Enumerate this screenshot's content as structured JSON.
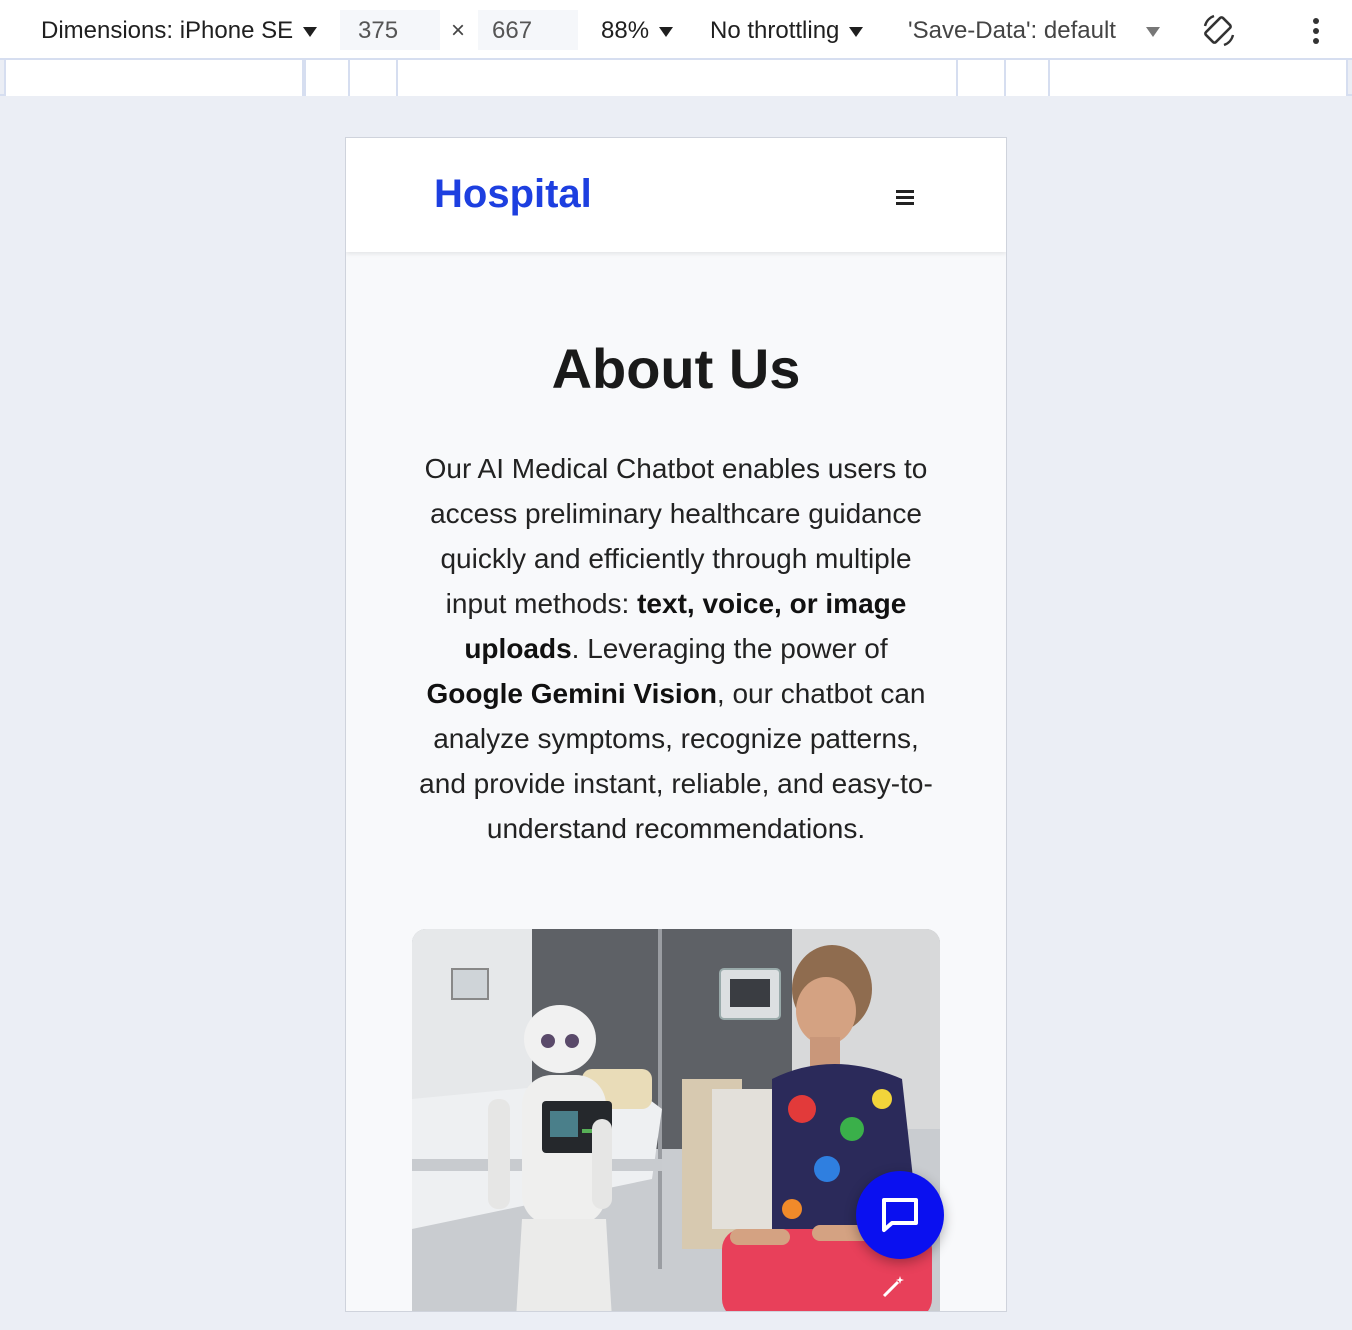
{
  "devtools": {
    "dimensions_label": "Dimensions: iPhone SE",
    "width": "375",
    "times": "×",
    "height": "667",
    "zoom": "88%",
    "throttling": "No throttling",
    "save_data": "'Save-Data': default"
  },
  "site": {
    "brand": "Hospital",
    "page_title": "About Us",
    "intro_1": "Our AI Medical Chatbot enables users to access preliminary healthcare guidance quickly and efficiently through multiple input methods: ",
    "intro_bold_1": "text, voice, or image uploads",
    "intro_2": ". Leveraging the power of ",
    "intro_bold_2": "Google Gemini Vision",
    "intro_3": ", our chatbot can analyze symptoms, recognize patterns, and provide instant, reliable, and easy-to-understand recommendations."
  },
  "colors": {
    "brand": "#1d3fe0",
    "fab": "#0a10f0"
  },
  "icons": {
    "menu": "hamburger-icon",
    "chat": "chat-bubble-icon",
    "rotate": "rotate-icon",
    "more": "more-vertical-icon",
    "wand": "magic-wand-icon"
  }
}
